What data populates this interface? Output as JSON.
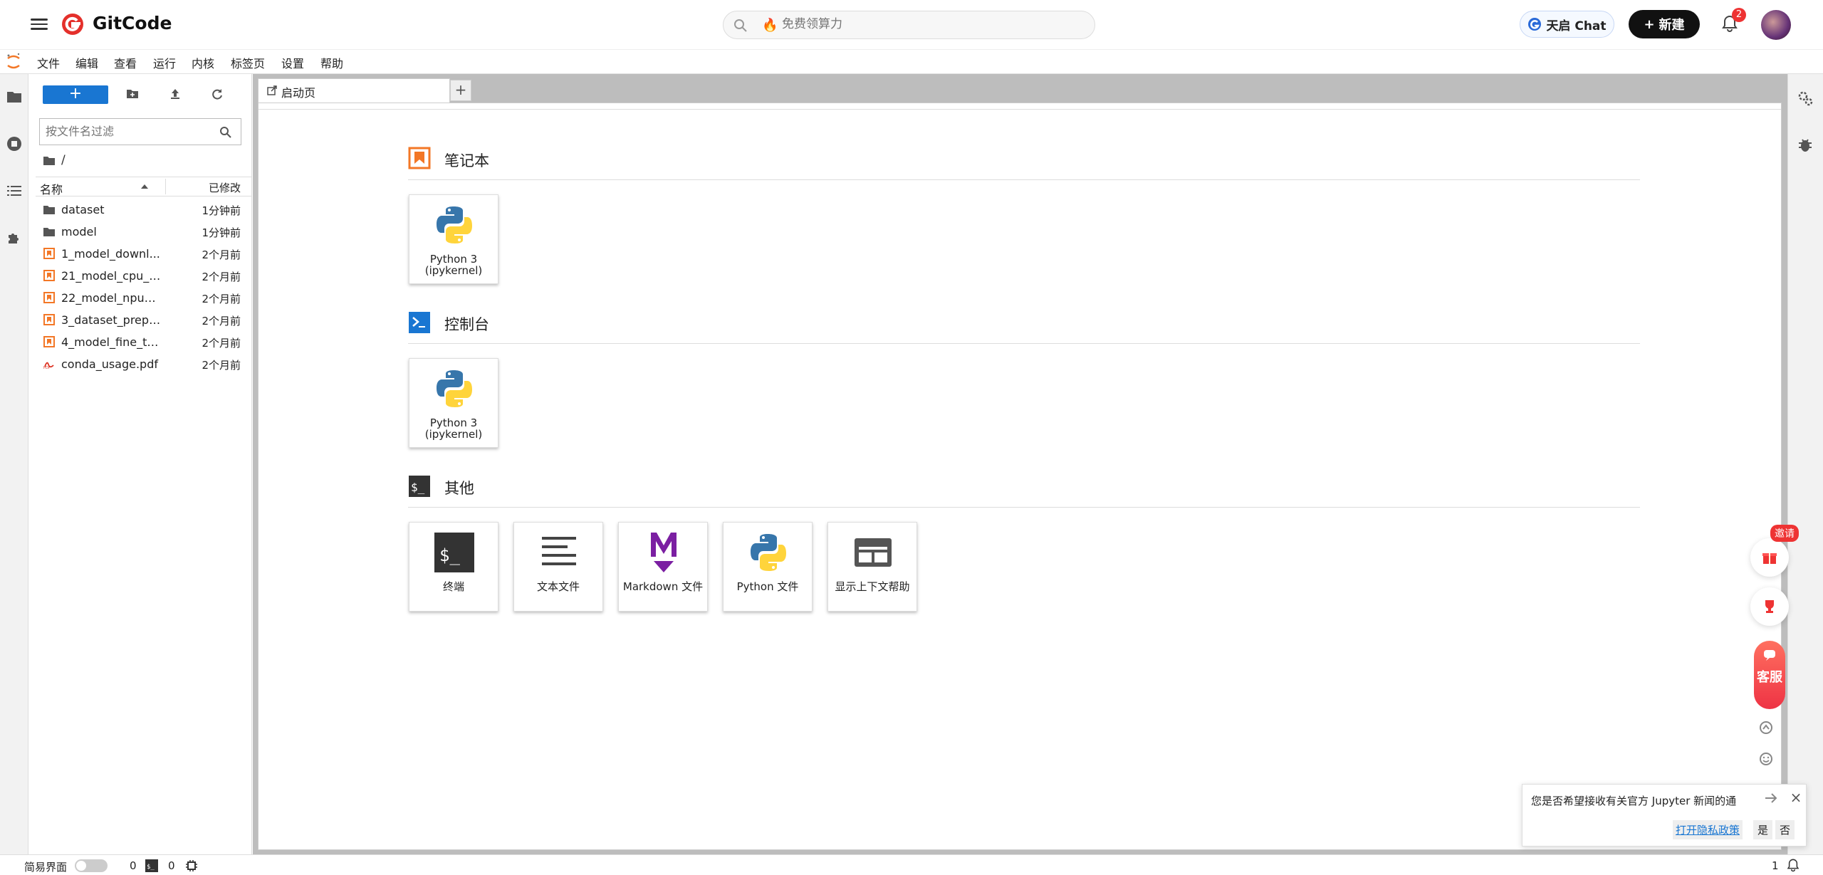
{
  "topbar": {
    "brand": "GitCode",
    "search_placeholder": "免费领算力",
    "chat_label": "天启 Chat",
    "new_label": "新建",
    "notification_count": "2"
  },
  "menu": [
    "文件",
    "编辑",
    "查看",
    "运行",
    "内核",
    "标签页",
    "设置",
    "帮助"
  ],
  "filebrowser": {
    "new_label": "+",
    "filter_placeholder": "按文件名过滤",
    "breadcrumb": "/",
    "col_name": "名称",
    "col_modified": "已修改",
    "items": [
      {
        "name": "dataset",
        "modified": "1分钟前",
        "type": "folder"
      },
      {
        "name": "model",
        "modified": "1分钟前",
        "type": "folder"
      },
      {
        "name": "1_model_downl...",
        "modified": "2个月前",
        "type": "notebook"
      },
      {
        "name": "21_model_cpu_i...",
        "modified": "2个月前",
        "type": "notebook"
      },
      {
        "name": "22_model_npu_i...",
        "modified": "2个月前",
        "type": "notebook"
      },
      {
        "name": "3_dataset_prepa...",
        "modified": "2个月前",
        "type": "notebook"
      },
      {
        "name": "4_model_fine_tu...",
        "modified": "2个月前",
        "type": "notebook"
      },
      {
        "name": "conda_usage.pdf",
        "modified": "2个月前",
        "type": "pdf"
      }
    ]
  },
  "tab": {
    "label": "启动页",
    "add": "+"
  },
  "launcher": {
    "notebook": {
      "title": "笔记本",
      "cards": [
        {
          "line1": "Python 3",
          "line2": "(ipykernel)"
        }
      ]
    },
    "console": {
      "title": "控制台",
      "cards": [
        {
          "line1": "Python 3",
          "line2": "(ipykernel)"
        }
      ]
    },
    "other": {
      "title": "其他",
      "cards": [
        {
          "label": "终端"
        },
        {
          "label": "文本文件"
        },
        {
          "label": "Markdown 文件"
        },
        {
          "label": "Python 文件"
        },
        {
          "label": "显示上下文帮助"
        }
      ]
    }
  },
  "floating": {
    "invite": "邀请",
    "service": "客服"
  },
  "notification": {
    "message": "您是否希望接收有关官方 Jupyter 新闻的通",
    "privacy_link": "打开隐私政策",
    "yes": "是",
    "no": "否",
    "close": "×"
  },
  "statusbar": {
    "simple_mode": "简易界面",
    "terminals": "0",
    "kernels": "0",
    "right_count": "1"
  },
  "colors": {
    "primary": "#1976d2",
    "notebook_orange": "#f37726",
    "danger": "#ee3344"
  }
}
